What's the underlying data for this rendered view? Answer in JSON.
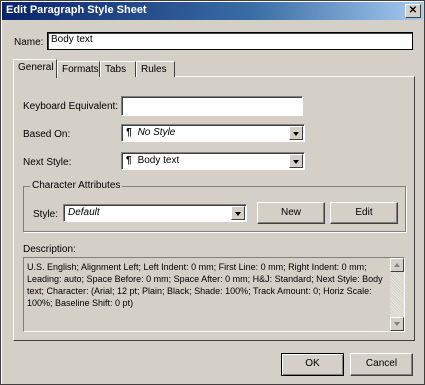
{
  "title": "Edit Paragraph Style Sheet",
  "close_glyph": "✕",
  "name": {
    "label": "Name:",
    "value": "Body text"
  },
  "tabs": [
    {
      "label": "General",
      "active": true
    },
    {
      "label": "Formats",
      "active": false
    },
    {
      "label": "Tabs",
      "active": false
    },
    {
      "label": "Rules",
      "active": false
    }
  ],
  "general": {
    "keyboard_label": "Keyboard Equivalent:",
    "keyboard_value": "",
    "based_on_label": "Based On:",
    "based_on_value": "No Style",
    "next_style_label": "Next Style:",
    "next_style_value": "Body text",
    "pilcrow": "¶"
  },
  "character": {
    "legend": "Character Attributes",
    "style_label": "Style:",
    "style_value": "Default",
    "new_label": "New",
    "edit_label": "Edit"
  },
  "description": {
    "label": "Description:",
    "text": "U.S. English;  Alignment Left;  Left Indent: 0 mm;  First Line: 0 mm;  Right Indent: 0 mm;  Leading: auto;  Space Before: 0 mm;  Space After: 0 mm;  H&J: Standard;  Next Style: Body text;  Character: (Arial;  12 pt;  Plain;  Black;  Shade: 100%;  Track Amount: 0;  Horiz Scale: 100%;  Baseline Shift: 0 pt)"
  },
  "ok_label": "OK",
  "cancel_label": "Cancel"
}
